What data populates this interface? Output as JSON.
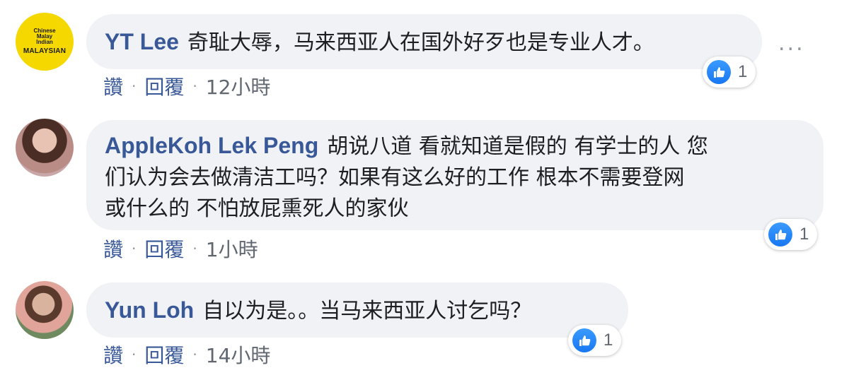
{
  "comments": [
    {
      "author": "YT Lee",
      "text": "奇耻大辱，马来西亚人在国外好歹也是专业人才。",
      "avatar_text": [
        "Chinese",
        "Malay",
        "Indian",
        "MALAYSIAN"
      ],
      "like_label": "讚",
      "reply_label": "回覆",
      "time": "12小時",
      "reactions": "1"
    },
    {
      "author": "AppleKoh Lek Peng",
      "text_lines": [
        "胡说八道 看就知道是假的 有学士的人 您",
        "们认为会去做清洁工吗？如果有这么好的工作 根本不需要登网",
        "或什么的 不怕放屁熏死人的家伙"
      ],
      "like_label": "讚",
      "reply_label": "回覆",
      "time": "1小時",
      "reactions": "1"
    },
    {
      "author": "Yun Loh",
      "text": "自以为是。。当马来西亚人讨乞吗？",
      "like_label": "讚",
      "reply_label": "回覆",
      "time": "14小時",
      "reactions": "1"
    }
  ],
  "more_options": "...",
  "separator": "·",
  "colors": {
    "name": "#385898",
    "bubble": "#f0f2f5",
    "like": "#1877f2"
  },
  "icons": {
    "reaction": "like-thumb-icon",
    "more": "more-options-icon"
  }
}
